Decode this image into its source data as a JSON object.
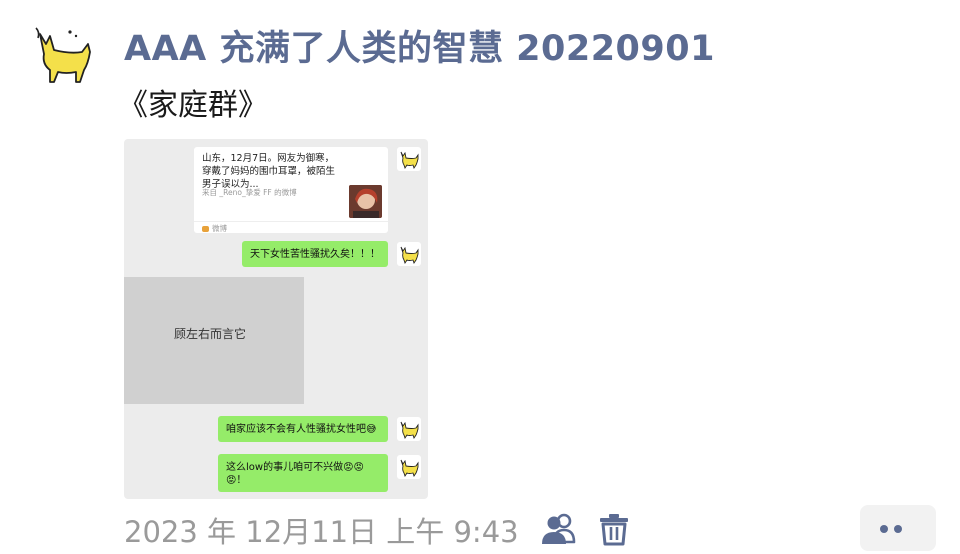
{
  "post": {
    "title": "AAA 充满了人类的智慧 20220901",
    "subtitle": "《家庭群》",
    "timestamp": "2023 年 12月11日 上午 9:43"
  },
  "screenshot": {
    "shared_card": {
      "text": "山东，12月7日。网友为御寒，穿戴了妈妈的围巾耳罩，被陌生男子误以为...",
      "source": "来自 _Reno_挚爱 FF 的微博",
      "app": "微博"
    },
    "messages": [
      {
        "text": "天下女性苦性骚扰久矣！！！"
      },
      {
        "text": "咱家应该不会有人性骚扰女性吧😅"
      },
      {
        "text": "这么low的事儿咱可不兴做😡😡😡！"
      }
    ],
    "image_placeholder_text": "顾左右而言它"
  },
  "icons": {
    "avatar": "yellow-cat-icon",
    "people": "people-icon",
    "delete": "trash-icon",
    "more": "more-dots-icon"
  },
  "colors": {
    "accent": "#5b6b92",
    "bubble_green": "#95ec69",
    "timestamp_grey": "#9a9a9a"
  }
}
